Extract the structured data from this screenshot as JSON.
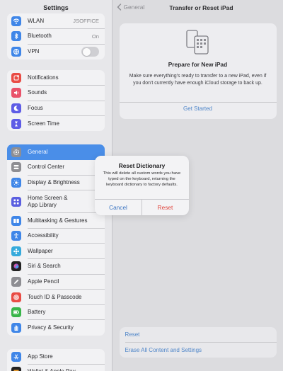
{
  "sidebar": {
    "title": "Settings",
    "group1": [
      {
        "icon": "wifi-icon",
        "color": "#3f86e8",
        "label": "WLAN",
        "value": "JSOFFICE"
      },
      {
        "icon": "bluetooth-icon",
        "color": "#3f86e8",
        "label": "Bluetooth",
        "value": "On"
      },
      {
        "icon": "vpn-icon",
        "color": "#3f86e8",
        "label": "VPN",
        "toggle": false
      }
    ],
    "group2": [
      {
        "icon": "notifications-icon",
        "color": "#e94c45",
        "label": "Notifications"
      },
      {
        "icon": "sounds-icon",
        "color": "#e9526a",
        "label": "Sounds"
      },
      {
        "icon": "focus-icon",
        "color": "#5e5ce6",
        "label": "Focus"
      },
      {
        "icon": "screen-time-icon",
        "color": "#5e5ce6",
        "label": "Screen Time"
      }
    ],
    "group3": [
      {
        "icon": "gear-icon",
        "color": "#8e8e93",
        "label": "General",
        "selected": true
      },
      {
        "icon": "control-center-icon",
        "color": "#8e8e93",
        "label": "Control Center"
      },
      {
        "icon": "display-brightness-icon",
        "color": "#3f86e8",
        "label": "Display & Brightness"
      },
      {
        "icon": "home-screen-icon",
        "color": "#5b5fe0",
        "label": "Home Screen & App Library",
        "tall": true
      },
      {
        "icon": "multitasking-icon",
        "color": "#3f86e8",
        "label": "Multitasking & Gestures"
      },
      {
        "icon": "accessibility-icon",
        "color": "#3f86e8",
        "label": "Accessibility"
      },
      {
        "icon": "wallpaper-icon",
        "color": "#35aadc",
        "label": "Wallpaper"
      },
      {
        "icon": "siri-icon",
        "color": "#222222",
        "label": "Siri & Search"
      },
      {
        "icon": "apple-pencil-icon",
        "color": "#8e8e93",
        "label": "Apple Pencil"
      },
      {
        "icon": "touch-id-icon",
        "color": "#e94c45",
        "label": "Touch ID & Passcode"
      },
      {
        "icon": "battery-icon",
        "color": "#39b54a",
        "label": "Battery"
      },
      {
        "icon": "privacy-hand-icon",
        "color": "#3f86e8",
        "label": "Privacy & Security"
      }
    ],
    "group4": [
      {
        "icon": "app-store-icon",
        "color": "#3f86e8",
        "label": "App Store"
      },
      {
        "icon": "wallet-icon",
        "color": "#222222",
        "label": "Wallet & Apple Pay"
      }
    ]
  },
  "nav": {
    "back_label": "General",
    "title": "Transfer or Reset iPad"
  },
  "prepare": {
    "title": "Prepare for New iPad",
    "description": "Make sure everything's ready to transfer to a new iPad, even if you don't currently have enough iCloud storage to back up.",
    "link": "Get Started"
  },
  "reset_group": {
    "reset": "Reset",
    "erase": "Erase All Content and Settings"
  },
  "alert": {
    "title": "Reset Dictionary",
    "message": "This will delete all custom words you have typed on the keyboard, returning the keyboard dictionary to factory defaults.",
    "cancel": "Cancel",
    "reset": "Reset"
  },
  "colors": {
    "accent": "#4f86c9",
    "destructive": "#e0453d",
    "selected": "#4a8ee8"
  }
}
